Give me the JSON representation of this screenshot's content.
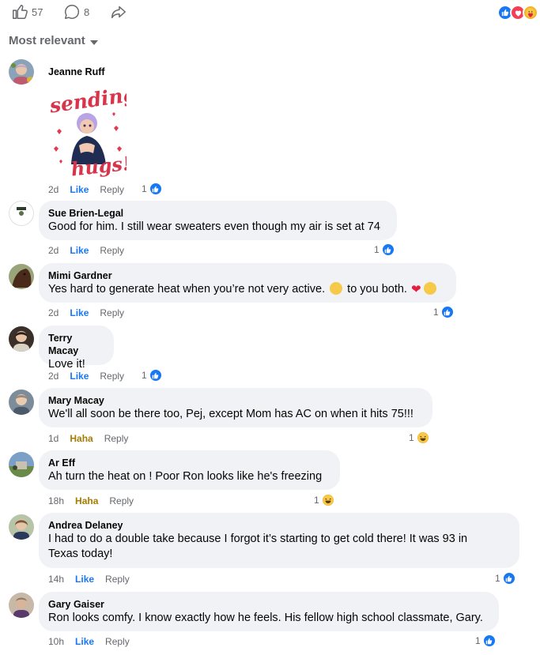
{
  "topbar": {
    "likes_count": "57",
    "comments_count": "8",
    "reaction_icons": [
      "like",
      "love",
      "care"
    ]
  },
  "sort": {
    "label": "Most relevant"
  },
  "sticker": {
    "line1": "sending",
    "line2": "hugs!"
  },
  "comments": [
    {
      "name": "Jeanne Ruff",
      "text": "",
      "time": "2d",
      "action": "Like",
      "reply": "Reply",
      "reaction_count": "1",
      "reaction": "like"
    },
    {
      "name": "Sue Brien-Legal",
      "text": "Good for him. I still wear sweaters even though my air is set at 74",
      "time": "2d",
      "action": "Like",
      "reply": "Reply",
      "reaction_count": "1",
      "reaction": "like"
    },
    {
      "name": "Mimi Gardner",
      "text_part1": "Yes hard to generate heat when you’re not very active.",
      "text_part2": "to you both.",
      "time": "2d",
      "action": "Like",
      "reply": "Reply",
      "reaction_count": "1",
      "reaction": "like"
    },
    {
      "name": "Terry Macay",
      "text": "Love it!",
      "time": "2d",
      "action": "Like",
      "reply": "Reply",
      "reaction_count": "1",
      "reaction": "like"
    },
    {
      "name": "Mary Macay",
      "text": "We'll all soon be there too, Pej, except Mom has AC on when it hits 75!!!",
      "time": "1d",
      "action": "Haha",
      "reply": "Reply",
      "reaction_count": "1",
      "reaction": "haha"
    },
    {
      "name": "Ar Eff",
      "text": "Ah turn the heat on ! Poor Ron looks like he's freezing",
      "time": "18h",
      "action": "Haha",
      "reply": "Reply",
      "reaction_count": "1",
      "reaction": "haha"
    },
    {
      "name": "Andrea Delaney",
      "text_line1": "I had to do a double take because I forgot it’s starting to get cold there! It was 93 in",
      "text_line2": "Texas today!",
      "time": "14h",
      "action": "Like",
      "reply": "Reply",
      "reaction_count": "1",
      "reaction": "like"
    },
    {
      "name": "Gary Gaiser",
      "text": "Ron looks comfy. I know exactly how he feels. His fellow high school classmate, Gary.",
      "time": "10h",
      "action": "Like",
      "reply": "Reply",
      "reaction_count": "1",
      "reaction": "like"
    }
  ],
  "colors": {
    "like_blue": "#1877f2",
    "haha_gold": "#a57c00",
    "bubble_bg": "#f0f2f5",
    "meta_gray": "#65676b"
  }
}
